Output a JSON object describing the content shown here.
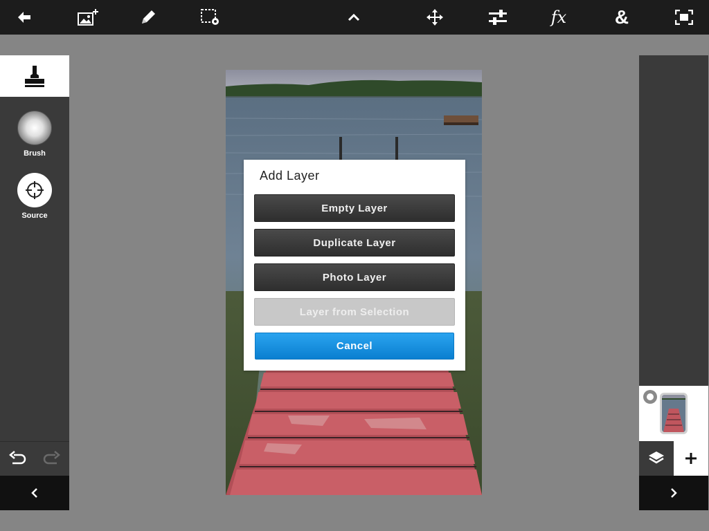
{
  "toolbar": {
    "icons": [
      "back-arrow-icon",
      "add-image-icon",
      "pencil-icon",
      "selection-settings-icon",
      "chevron-up-icon",
      "move-icon",
      "adjustments-icon",
      "fx-icon",
      "ampersand-icon",
      "fullscreen-icon"
    ],
    "fx_label": "fx",
    "amp_label": "&"
  },
  "left_panel": {
    "active_tool": "clone-stamp-icon",
    "options": [
      {
        "label": "Brush",
        "icon": "brush-softness-icon"
      },
      {
        "label": "Source",
        "icon": "crosshair-icon"
      }
    ],
    "undo_icon": "undo-icon",
    "redo_icon": "redo-icon",
    "collapse_icon": "chevron-left-icon"
  },
  "right_panel": {
    "layers_icon": "layers-icon",
    "add_icon": "plus-icon",
    "collapse_icon": "chevron-right-icon"
  },
  "dialog": {
    "title": "Add Layer",
    "buttons": {
      "empty": "Empty Layer",
      "duplicate": "Duplicate Layer",
      "photo": "Photo Layer",
      "selection": "Layer from Selection",
      "cancel": "Cancel"
    }
  },
  "colors": {
    "toolbar_bg": "#1c1c1c",
    "panel_bg": "#3a3a3a",
    "workspace_bg": "#858585",
    "accent_blue": "#1a8fe0",
    "dock_red": "#c0565e"
  }
}
